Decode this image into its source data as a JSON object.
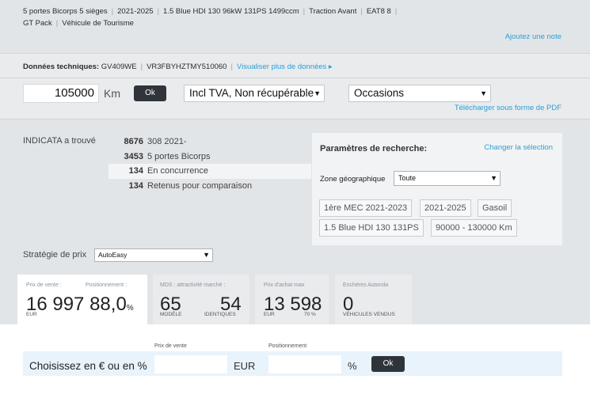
{
  "vehicle": {
    "spec_parts": [
      "5 portes Bicorps 5 sièges",
      "2021-2025",
      "1.5 Blue HDI 130 96kW 131PS 1499ccm",
      "Traction Avant",
      "EAT8 8"
    ],
    "spec_parts2": [
      "GT Pack",
      "Véhicule de Tourisme"
    ],
    "add_note": "Ajoutez une note"
  },
  "tech": {
    "label": "Données techniques:",
    "plate": "GV409WE",
    "vin": "VR3FBYHZTMY510060",
    "more_link": "Visualiser plus de données ▸"
  },
  "inputs": {
    "km_value": "105000",
    "km_unit": "Km",
    "ok_label": "Ok",
    "tva_selected": "Incl TVA, Non récupérable",
    "occasions_selected": "Occasions",
    "pdf_link": "Télécharger sous forme de PDF"
  },
  "found": {
    "label": "INDICATA a trouvé",
    "rows": [
      {
        "num": "8676",
        "label": "308 2021-"
      },
      {
        "num": "3453",
        "label": "5 portes Bicorps"
      },
      {
        "num": "134",
        "label": "En concurrence"
      },
      {
        "num": "134",
        "label": "Retenus pour comparaison"
      }
    ]
  },
  "params": {
    "title": "Paramètres de recherche:",
    "change_link": "Changer la sélection",
    "zone_label": "Zone géographique",
    "zone_selected": "Toute",
    "chips": [
      "1ère MEC 2021-2023",
      "2021-2025",
      "Gasoil",
      "1.5 Blue HDI 130 131PS",
      "90000 - 130000 Km"
    ]
  },
  "strategy": {
    "label": "Stratégie de prix",
    "selected": "AutoEasy"
  },
  "tiles": {
    "sale": {
      "sub1": "Prix de vente :",
      "sub2": "Positionnement :",
      "price": "16 997",
      "position": "88,0",
      "pct": "%",
      "unit": "EUR"
    },
    "mds": {
      "sub": "MDS : attractivité marché :",
      "model_value": "65",
      "identical_value": "54",
      "model_label": "MODÈLE",
      "identical_label": "IDENTIQUES"
    },
    "purchase": {
      "sub": "Prix d'achat max",
      "value": "13 598",
      "unit": "EUR",
      "pct": "70 %"
    },
    "auctions": {
      "sub": "Enchères Autorola",
      "value": "0",
      "label": "VÉHICULES VENDUS"
    }
  },
  "choose": {
    "price_label": "Prix de vente",
    "position_label": "Positionnement",
    "text": "Choisissez en € ou en %",
    "eur": "EUR",
    "pct": "%",
    "ok_label": "Ok"
  },
  "colors": {
    "accent_link": "#2a9fd8",
    "button": "#2f343a",
    "choose_bar": "#e9f3fb"
  }
}
